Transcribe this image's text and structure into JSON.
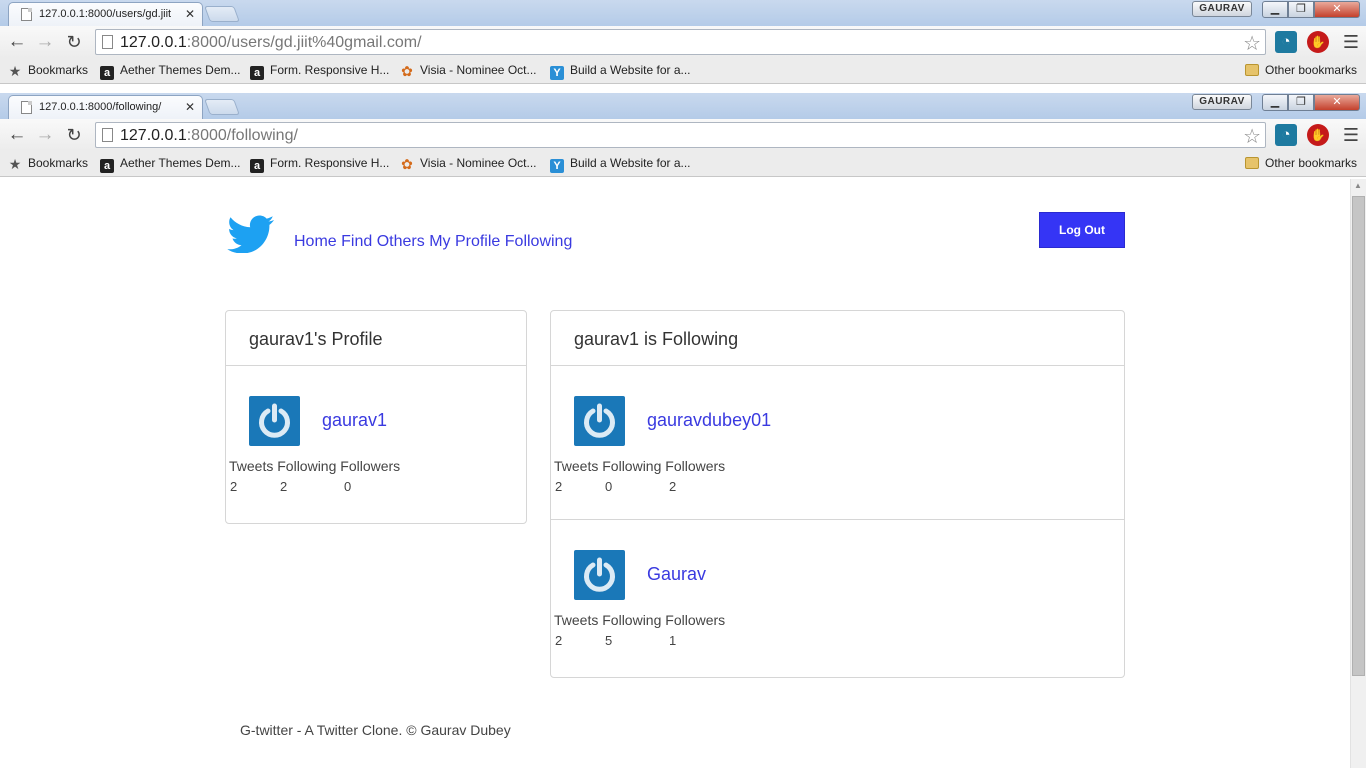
{
  "windows": [
    {
      "tab_title": "127.0.0.1:8000/users/gd.jiit",
      "url_host": "127.0.0.1",
      "url_rest": ":8000/users/gd.jiit%40gmail.com/",
      "user_badge": "GAURAV"
    },
    {
      "tab_title": "127.0.0.1:8000/following/",
      "url_host": "127.0.0.1",
      "url_rest": ":8000/following/",
      "user_badge": "GAURAV"
    }
  ],
  "bookmarks": {
    "label": "Bookmarks",
    "items": [
      {
        "label": "Aether Themes Dem...",
        "icon": "a-icon"
      },
      {
        "label": "Form. Responsive H...",
        "icon": "a-icon"
      },
      {
        "label": "Visia - Nominee Oct...",
        "icon": "visia-icon"
      },
      {
        "label": "Build a Website for a...",
        "icon": "y-icon"
      }
    ],
    "other": "Other bookmarks"
  },
  "nav": {
    "links": [
      "Home",
      "Find Others",
      "My Profile",
      "Following"
    ],
    "logout": "Log Out"
  },
  "profile": {
    "title": "gaurav1's Profile",
    "username": "gaurav1",
    "stats_header": "Tweets Following Followers",
    "tweets": "2",
    "following": "2",
    "followers": "0"
  },
  "following": {
    "title": "gaurav1 is Following",
    "users": [
      {
        "username": "gauravdubey01",
        "stats_header": "Tweets Following Followers",
        "tweets": "2",
        "following": "0",
        "followers": "2"
      },
      {
        "username": "Gaurav",
        "stats_header": "Tweets Following Followers",
        "tweets": "2",
        "following": "5",
        "followers": "1"
      }
    ]
  },
  "footer": "G-twitter - A Twitter Clone. © Gaurav Dubey",
  "colors": {
    "link": "#3a3ae0",
    "logout_bg": "#3535f5",
    "avatar_bg": "#1a78b8",
    "twitter_bird": "#1da1f2"
  }
}
